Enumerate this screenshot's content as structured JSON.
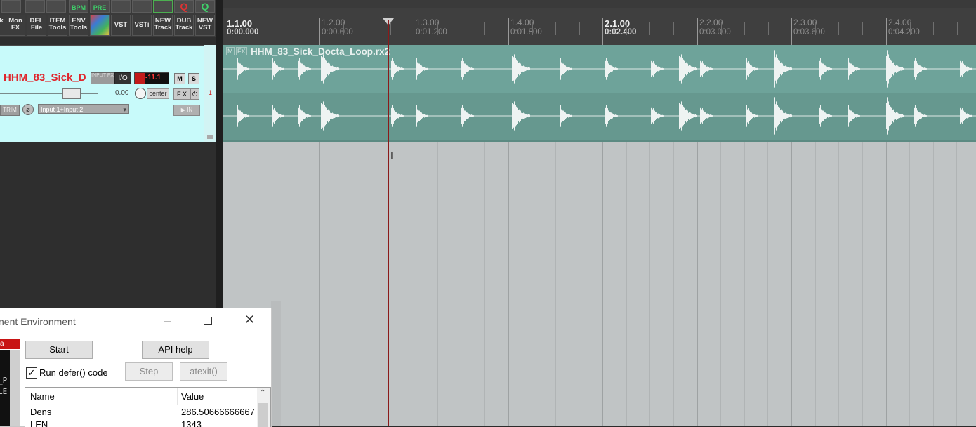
{
  "toolbar": {
    "buttons": [
      {
        "line1": "k",
        "line2": ""
      },
      {
        "line1": "Mon",
        "line2": "FX"
      },
      {
        "line1": "DEL",
        "line2": "File"
      },
      {
        "line1": "ITEM",
        "line2": "Tools"
      },
      {
        "line1": "ENV",
        "line2": "Tools"
      },
      {
        "line1": "",
        "line2": ""
      },
      {
        "line1": "VST",
        "line2": ""
      },
      {
        "line1": "VSTi",
        "line2": ""
      },
      {
        "line1": "NEW",
        "line2": "Track"
      },
      {
        "line1": "DUB",
        "line2": "Track"
      },
      {
        "line1": "NEW",
        "line2": "VST"
      }
    ],
    "icon_labels": {
      "bpm": "BPM",
      "pre": "PRE"
    }
  },
  "track": {
    "name": "HHM_83_Sick_D",
    "input_fx_label": "INPUT FX",
    "io_label": "I/O",
    "meter_value": "-11.1",
    "mute_label": "M",
    "solo_label": "S",
    "volume_value": "0.00",
    "pan_value": "center",
    "fx_label": "F X",
    "trim_label": "TRIM",
    "input_name": "Input 1+Input 2",
    "monitor_label": "IN",
    "track_number": "1"
  },
  "timeline": {
    "markers": [
      {
        "beat": "1.1.00",
        "time": "0:00.000",
        "major": true
      },
      {
        "beat": "1.2.00",
        "time": "0:00.600",
        "major": false
      },
      {
        "beat": "1.3.00",
        "time": "0:01.200",
        "major": false
      },
      {
        "beat": "1.4.00",
        "time": "0:01.800",
        "major": false
      },
      {
        "beat": "2.1.00",
        "time": "0:02.400",
        "major": true
      },
      {
        "beat": "2.2.00",
        "time": "0:03.000",
        "major": false
      },
      {
        "beat": "2.3.00",
        "time": "0:03.600",
        "major": false
      },
      {
        "beat": "2.4.00",
        "time": "0:04.200",
        "major": false
      }
    ]
  },
  "media_item": {
    "title": "HHM_83_Sick_Docta_Loop.rx2",
    "badges": [
      "M",
      "FX"
    ]
  },
  "dialog": {
    "title": "nent Environment",
    "start_label": "Start",
    "api_help_label": "API help",
    "run_defer_label": "Run defer() code",
    "run_defer_checked": true,
    "step_label": "Step",
    "atexit_label": "atexit()",
    "table": {
      "columns": [
        "Name",
        "Value"
      ],
      "rows": [
        {
          "name": "Dens",
          "value": "286.50666666667"
        },
        {
          "name": "LEN",
          "value": "1343"
        }
      ]
    },
    "editor_fragments": [
      "a",
      "_P",
      "LE"
    ]
  },
  "colors": {
    "track_bg": "#c8fafa",
    "track_name": "#e0252b",
    "media_item": "#6c9f96",
    "arrange_bg": "#c0c4c5",
    "play_cursor": "#8a1a1a"
  }
}
